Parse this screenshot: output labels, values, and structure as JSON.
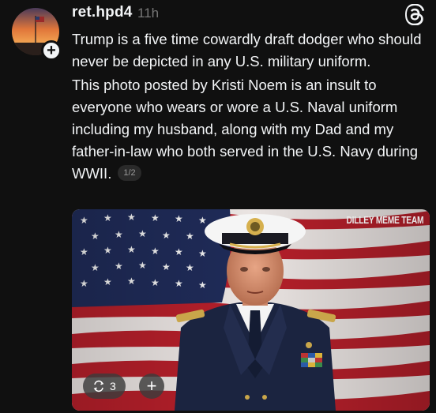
{
  "post": {
    "username": "ret.hpd4",
    "timestamp": "11h",
    "paragraph1": "Trump is a five time cowardly draft dodger who should never be depicted in any U.S. military uniform.",
    "paragraph2": "This photo posted by Kristi Noem is an insult to everyone who wears or wore a U.S. Naval uniform including my husband, along with my Dad and my father-in-law who both served in the U.S. Navy during WWII.",
    "page_indicator": "1/2",
    "follow_symbol": "+"
  },
  "media": {
    "watermark": "DILLEY MEME TEAM",
    "stack_count": "3",
    "add_symbol": "+"
  },
  "icons": {
    "app_logo": "threads-logo-icon",
    "avatar": "sunset-flag-avatar",
    "stack": "repost-stack-icon"
  },
  "colors": {
    "background": "#101010",
    "text": "#f3f5f7",
    "muted": "#777777"
  }
}
